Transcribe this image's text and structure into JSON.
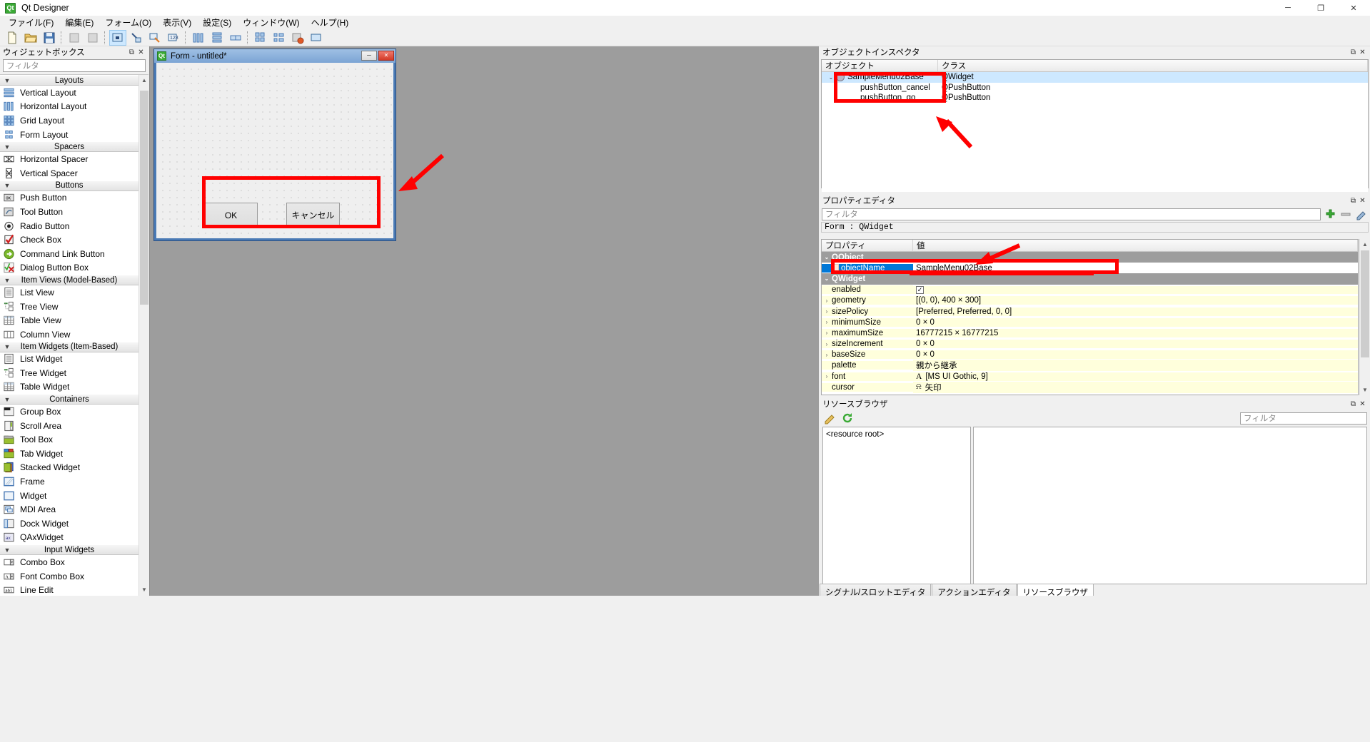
{
  "window": {
    "title": "Qt Designer",
    "app_icon": "qt-logo-icon",
    "minimize": "─",
    "maximize": "❐",
    "close": "✕"
  },
  "menubar": {
    "items": [
      {
        "label": "ファイル(F)",
        "name": "menu-file"
      },
      {
        "label": "編集(E)",
        "name": "menu-edit"
      },
      {
        "label": "フォーム(O)",
        "name": "menu-form"
      },
      {
        "label": "表示(V)",
        "name": "menu-view"
      },
      {
        "label": "設定(S)",
        "name": "menu-settings"
      },
      {
        "label": "ウィンドウ(W)",
        "name": "menu-window"
      },
      {
        "label": "ヘルプ(H)",
        "name": "menu-help"
      }
    ]
  },
  "toolbar": {
    "buttons": [
      "new-file-icon",
      "open-folder-icon",
      "save-icon",
      "sep",
      "undo-icon",
      "redo-icon",
      "sep",
      "edit-widgets-icon",
      "edit-signals-slots-icon",
      "edit-buddies-icon",
      "edit-tab-order-icon",
      "sep",
      "layout-horizontal-icon",
      "layout-vertical-icon",
      "layout-splitter-h-icon",
      "layout-grid-icon",
      "layout-form-icon",
      "break-layout-icon",
      "adjust-size-icon"
    ]
  },
  "widgetbox": {
    "title": "ウィジェットボックス",
    "float_icon": "float-icon",
    "close_icon": "close-icon",
    "filter_placeholder": "フィルタ",
    "categories": [
      {
        "name": "Layouts",
        "expanded": true,
        "items": [
          {
            "label": "Vertical Layout",
            "icon": "vertical-layout-icon"
          },
          {
            "label": "Horizontal Layout",
            "icon": "horizontal-layout-icon"
          },
          {
            "label": "Grid Layout",
            "icon": "grid-layout-icon"
          },
          {
            "label": "Form Layout",
            "icon": "form-layout-icon"
          }
        ]
      },
      {
        "name": "Spacers",
        "expanded": true,
        "items": [
          {
            "label": "Horizontal Spacer",
            "icon": "horizontal-spacer-icon"
          },
          {
            "label": "Vertical Spacer",
            "icon": "vertical-spacer-icon"
          }
        ]
      },
      {
        "name": "Buttons",
        "expanded": true,
        "items": [
          {
            "label": "Push Button",
            "icon": "push-button-icon"
          },
          {
            "label": "Tool Button",
            "icon": "tool-button-icon"
          },
          {
            "label": "Radio Button",
            "icon": "radio-button-icon"
          },
          {
            "label": "Check Box",
            "icon": "check-box-icon"
          },
          {
            "label": "Command Link Button",
            "icon": "command-link-button-icon"
          },
          {
            "label": "Dialog Button Box",
            "icon": "dialog-button-box-icon"
          }
        ]
      },
      {
        "name": "Item Views (Model-Based)",
        "expanded": true,
        "items": [
          {
            "label": "List View",
            "icon": "list-view-icon"
          },
          {
            "label": "Tree View",
            "icon": "tree-view-icon"
          },
          {
            "label": "Table View",
            "icon": "table-view-icon"
          },
          {
            "label": "Column View",
            "icon": "column-view-icon"
          }
        ]
      },
      {
        "name": "Item Widgets (Item-Based)",
        "expanded": true,
        "items": [
          {
            "label": "List Widget",
            "icon": "list-widget-icon"
          },
          {
            "label": "Tree Widget",
            "icon": "tree-widget-icon"
          },
          {
            "label": "Table Widget",
            "icon": "table-widget-icon"
          }
        ]
      },
      {
        "name": "Containers",
        "expanded": true,
        "items": [
          {
            "label": "Group Box",
            "icon": "group-box-icon"
          },
          {
            "label": "Scroll Area",
            "icon": "scroll-area-icon"
          },
          {
            "label": "Tool Box",
            "icon": "tool-box-icon"
          },
          {
            "label": "Tab Widget",
            "icon": "tab-widget-icon"
          },
          {
            "label": "Stacked Widget",
            "icon": "stacked-widget-icon"
          },
          {
            "label": "Frame",
            "icon": "frame-icon"
          },
          {
            "label": "Widget",
            "icon": "widget-icon"
          },
          {
            "label": "MDI Area",
            "icon": "mdi-area-icon"
          },
          {
            "label": "Dock Widget",
            "icon": "dock-widget-icon"
          },
          {
            "label": "QAxWidget",
            "icon": "qaxwidget-icon"
          }
        ]
      },
      {
        "name": "Input Widgets",
        "expanded": true,
        "items": [
          {
            "label": "Combo Box",
            "icon": "combo-box-icon"
          },
          {
            "label": "Font Combo Box",
            "icon": "font-combo-box-icon"
          },
          {
            "label": "Line Edit",
            "icon": "line-edit-icon"
          }
        ]
      }
    ]
  },
  "form": {
    "title": "Form - untitled*",
    "icon": "qt-logo-icon",
    "minimize": "─",
    "maximize": "❐",
    "close": "✕",
    "buttons": [
      {
        "label": "OK",
        "name": "form-ok-button"
      },
      {
        "label": "キャンセル",
        "name": "form-cancel-button"
      }
    ]
  },
  "object_inspector": {
    "title": "オブジェクトインスペクタ",
    "float_icon": "float-icon",
    "close_icon": "close-icon",
    "columns": [
      "オブジェクト",
      "クラス"
    ],
    "rows": [
      {
        "object": "SampleMenu02Base",
        "class": "QWidget",
        "depth": 0,
        "selected": true,
        "expander": "⌄"
      },
      {
        "object": "pushButton_cancel",
        "class": "QPushButton",
        "depth": 1,
        "selected": false,
        "expander": ""
      },
      {
        "object": "pushButton_go",
        "class": "QPushButton",
        "depth": 1,
        "selected": false,
        "expander": ""
      }
    ]
  },
  "property_editor": {
    "title": "プロパティエディタ",
    "float_icon": "float-icon",
    "close_icon": "close-icon",
    "filter_placeholder": "フィルタ",
    "add_icon": "add-icon",
    "remove_icon": "remove-icon",
    "configure_icon": "configure-icon",
    "object_line": "Form : QWidget",
    "columns": [
      "プロパティ",
      "値"
    ],
    "rows": [
      {
        "name": "QObject",
        "value": "",
        "type": "group",
        "expander": "⌄"
      },
      {
        "name": "objectName",
        "value": "SampleMenu02Base",
        "type": "selected",
        "expander": ""
      },
      {
        "name": "QWidget",
        "value": "",
        "type": "group",
        "expander": "⌄"
      },
      {
        "name": "enabled",
        "value": "",
        "type": "checkbox",
        "checked": true,
        "expander": ""
      },
      {
        "name": "geometry",
        "value": "[(0, 0), 400 × 300]",
        "type": "normal",
        "expander": "›"
      },
      {
        "name": "sizePolicy",
        "value": "[Preferred, Preferred, 0, 0]",
        "type": "normal",
        "expander": "›"
      },
      {
        "name": "minimumSize",
        "value": "0 × 0",
        "type": "normal",
        "expander": "›"
      },
      {
        "name": "maximumSize",
        "value": "16777215 × 16777215",
        "type": "normal",
        "expander": "›"
      },
      {
        "name": "sizeIncrement",
        "value": "0 × 0",
        "type": "normal",
        "expander": "›"
      },
      {
        "name": "baseSize",
        "value": "0 × 0",
        "type": "normal",
        "expander": "›"
      },
      {
        "name": "palette",
        "value": "親から継承",
        "type": "normal",
        "expander": ""
      },
      {
        "name": "font",
        "value": "[MS UI Gothic, 9]",
        "type": "font",
        "expander": "›"
      },
      {
        "name": "cursor",
        "value": "矢印",
        "type": "cursor",
        "expander": ""
      }
    ]
  },
  "resource_browser": {
    "title": "リソースブラウザ",
    "float_icon": "float-icon",
    "close_icon": "close-icon",
    "edit_icon": "pencil-icon",
    "reload_icon": "reload-icon",
    "filter_placeholder": "フィルタ",
    "root_label": "<resource root>"
  },
  "bottom_tabs": [
    {
      "label": "シグナル/スロットエディタ",
      "active": false
    },
    {
      "label": "アクションエディタ",
      "active": false
    },
    {
      "label": "リソースブラウザ",
      "active": true
    }
  ],
  "annotations": {
    "color": "#ff0000",
    "boxes": [
      {
        "name": "annot-box-form-buttons"
      },
      {
        "name": "annot-box-object-inspector"
      },
      {
        "name": "annot-box-objectname-row"
      }
    ],
    "arrows": [
      {
        "name": "annot-arrow-to-form"
      },
      {
        "name": "annot-arrow-to-object-inspector"
      },
      {
        "name": "annot-arrow-to-objectname"
      }
    ],
    "underline": {
      "name": "annot-underline-objectname-value"
    }
  }
}
